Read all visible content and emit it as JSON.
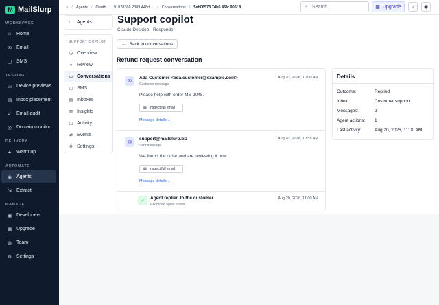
{
  "app": {
    "name": "MailSlurp"
  },
  "sidebar": {
    "sections": [
      {
        "title": "WORKSPACE",
        "items": [
          {
            "label": "Home",
            "icon": "home-icon",
            "glyph": "⌂"
          },
          {
            "label": "Email",
            "icon": "email-icon",
            "glyph": "✉"
          },
          {
            "label": "SMS",
            "icon": "sms-icon",
            "glyph": "▢"
          }
        ]
      },
      {
        "title": "TESTING",
        "items": [
          {
            "label": "Device previews",
            "icon": "device-icon",
            "glyph": "▭"
          },
          {
            "label": "Inbox placement",
            "icon": "inbox-icon",
            "glyph": "▤"
          },
          {
            "label": "Email audit",
            "icon": "audit-icon",
            "glyph": "✓"
          },
          {
            "label": "Domain monitor",
            "icon": "monitor-icon",
            "glyph": "◎"
          }
        ]
      },
      {
        "title": "DELIVERY",
        "items": [
          {
            "label": "Warm up",
            "icon": "flame-icon",
            "glyph": "✦"
          }
        ]
      },
      {
        "title": "AUTOMATE",
        "items": [
          {
            "label": "Agents",
            "icon": "agent-icon",
            "glyph": "◉",
            "active": true
          },
          {
            "label": "Extract",
            "icon": "extract-icon",
            "glyph": "⇲"
          }
        ]
      },
      {
        "title": "MANAGE",
        "items": [
          {
            "label": "Developers",
            "icon": "code-icon",
            "glyph": "▣"
          },
          {
            "label": "Upgrade",
            "icon": "upgrade-icon",
            "glyph": "▦"
          },
          {
            "label": "Team",
            "icon": "team-icon",
            "glyph": "◍"
          },
          {
            "label": "Settings",
            "icon": "gear-icon",
            "glyph": "⚙"
          }
        ]
      }
    ]
  },
  "breadcrumbs": [
    "Agents",
    "Oauth",
    "91078366 2389 448d ...",
    "Conversations",
    "5eb06573 7db5 45fc 906f 8..."
  ],
  "topbar": {
    "search_placeholder": "Search...",
    "upgrade_label": "Upgrade",
    "help_icon": "help-icon",
    "account_icon": "account-icon"
  },
  "subnav": {
    "top_label": "Agents",
    "section_title": "SUPPORT COPILOT",
    "items": [
      {
        "label": "Overview",
        "icon": "overview-icon",
        "glyph": "◷"
      },
      {
        "label": "Review",
        "icon": "review-icon",
        "glyph": "●"
      },
      {
        "label": "Conversations",
        "icon": "chat-icon",
        "glyph": "▭",
        "active": true
      },
      {
        "label": "SMS",
        "icon": "sms-icon",
        "glyph": "▢"
      },
      {
        "label": "Inboxes",
        "icon": "inbox-icon",
        "glyph": "▤"
      },
      {
        "label": "Insights",
        "icon": "insights-icon",
        "glyph": "▥"
      },
      {
        "label": "Activity",
        "icon": "activity-icon",
        "glyph": "◫"
      },
      {
        "label": "Events",
        "icon": "events-icon",
        "glyph": "⇄"
      },
      {
        "label": "Settings",
        "icon": "gear-icon",
        "glyph": "⚙"
      }
    ]
  },
  "page": {
    "title": "Support copilot",
    "subtitle": "Claude Desktop · Responder",
    "back_label": "Back to conversations",
    "conversation_title": "Refund request conversation"
  },
  "messages": [
    {
      "sender": "Ada Customer <ada.customer@example.com>",
      "role": "Customer message",
      "time": "Aug 20, 2026, 10:00 AM",
      "body": "Please help with order MS-2048.",
      "inspect_label": "Inspect full email",
      "details_label": "Message details"
    },
    {
      "sender": "support@mailslurp.biz",
      "role": "Sent message",
      "time": "Aug 20, 2026, 10:55 AM",
      "body": "We found the order and are reviewing it now.",
      "inspect_label": "Inspect full email",
      "details_label": "Message details"
    },
    {
      "sender": "Agent replied to the customer",
      "role": "Recorded agent action",
      "time": "Aug 20, 2026, 11:00 AM"
    }
  ],
  "details": {
    "title": "Details",
    "rows": [
      {
        "label": "Outcome:",
        "value": "Replied"
      },
      {
        "label": "Inbox:",
        "value": "Customer support"
      },
      {
        "label": "Messages:",
        "value": "2"
      },
      {
        "label": "Agent actions:",
        "value": "1"
      },
      {
        "label": "Last activity:",
        "value": "Aug 20, 2026, 11:00 AM"
      }
    ]
  }
}
